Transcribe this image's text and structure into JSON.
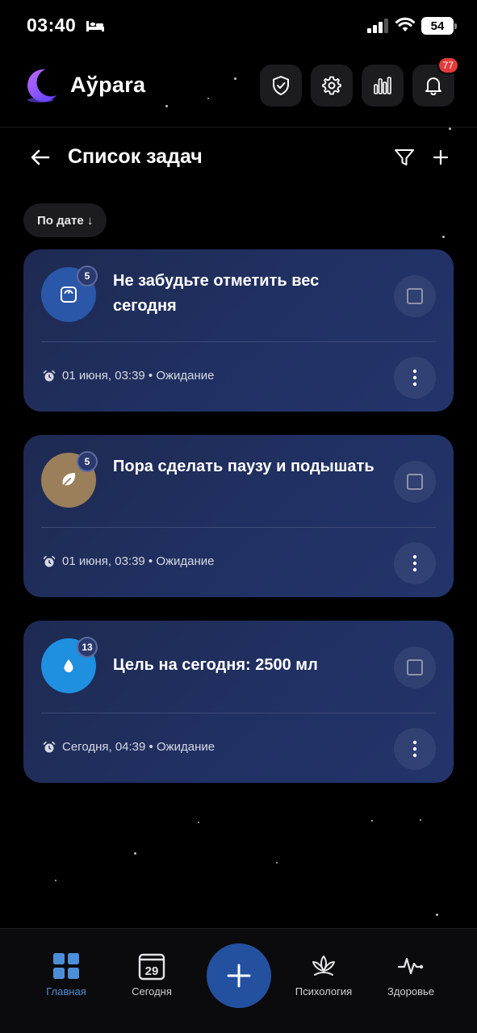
{
  "status_bar": {
    "time": "03:40",
    "battery": "54"
  },
  "header": {
    "app_name": "Аўрara",
    "notifications_count": "77"
  },
  "page": {
    "title": "Список задач",
    "sort_label": "По дате ↓"
  },
  "tasks": [
    {
      "title": "Не забудьте отметить вес сегодня",
      "badge": "5",
      "meta": "01 июня, 03:39 • Ожидание",
      "icon": "scale-icon",
      "color": "#2a57a8"
    },
    {
      "title": "Пора сделать паузу и подышать",
      "badge": "5",
      "meta": "01 июня, 03:39 • Ожидание",
      "icon": "leaf-icon",
      "color": "#9b7f5b"
    },
    {
      "title": "Цель на сегодня: 2500 мл",
      "badge": "13",
      "meta": "Сегодня, 04:39 • Ожидание",
      "icon": "water-drop-icon",
      "color": "#1f8fe0"
    }
  ],
  "nav": {
    "home": "Главная",
    "today": "Сегодня",
    "today_day": "29",
    "psychology": "Психология",
    "health": "Здоровье"
  },
  "colors": {
    "accent": "#4c8ed8",
    "card": "#213164",
    "fab": "#2450a0",
    "badge": "#e23b3b"
  }
}
